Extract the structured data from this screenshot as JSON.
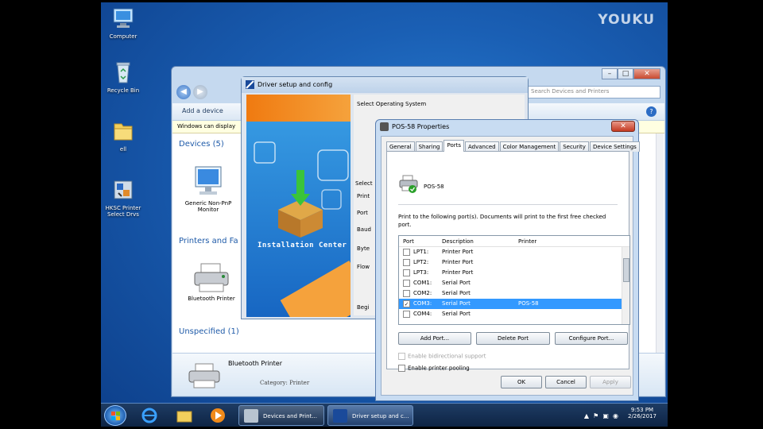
{
  "watermark": "YOUKU",
  "desktop": {
    "icons": [
      {
        "name": "computer",
        "label": "Computer"
      },
      {
        "name": "recycle-bin",
        "label": "Recycle Bin"
      },
      {
        "name": "folder",
        "label": "ell"
      },
      {
        "name": "installer",
        "label": "HKSC Printer\nSelect Drvs"
      }
    ]
  },
  "explorer": {
    "search_placeholder": "Search Devices and Printers",
    "add_device": "Add a device",
    "infobar": "Windows can display",
    "devices_header": "Devices (5)",
    "device_monitor": "Generic Non-PnP Monitor",
    "printers_header": "Printers and Fa",
    "printer_bt": "Bluetooth Printer",
    "unspecified_header": "Unspecified (1)",
    "details_name": "Bluetooth Printer",
    "details_category": "Category:  Printer"
  },
  "driver": {
    "title": "Driver setup and config",
    "select_os": "Select Operating System",
    "banner_label": "Installation Center",
    "side_labels": [
      "Select",
      "Print",
      "Port",
      "Baud",
      "Byte",
      "Flow"
    ],
    "bottom_label": "Begi"
  },
  "props": {
    "title": "POS-58 Properties",
    "tabs": [
      "General",
      "Sharing",
      "Ports",
      "Advanced",
      "Color Management",
      "Security",
      "Device Settings"
    ],
    "active_tab": "Ports",
    "printer_name": "POS-58",
    "description": "Print to the following port(s). Documents will print to the first free checked port.",
    "columns": {
      "port": "Port",
      "description": "Description",
      "printer": "Printer"
    },
    "ports": [
      {
        "port": "LPT1:",
        "description": "Printer Port",
        "printer": "",
        "checked": false,
        "selected": false
      },
      {
        "port": "LPT2:",
        "description": "Printer Port",
        "printer": "",
        "checked": false,
        "selected": false
      },
      {
        "port": "LPT3:",
        "description": "Printer Port",
        "printer": "",
        "checked": false,
        "selected": false
      },
      {
        "port": "COM1:",
        "description": "Serial Port",
        "printer": "",
        "checked": false,
        "selected": false
      },
      {
        "port": "COM2:",
        "description": "Serial Port",
        "printer": "",
        "checked": false,
        "selected": false
      },
      {
        "port": "COM3:",
        "description": "Serial Port",
        "printer": "POS-58",
        "checked": true,
        "selected": true
      },
      {
        "port": "COM4:",
        "description": "Serial Port",
        "printer": "",
        "checked": false,
        "selected": false
      }
    ],
    "add_port": "Add Port...",
    "delete_port": "Delete Port",
    "configure_port": "Configure Port...",
    "bidirectional": "Enable bidirectional support",
    "pooling": "Enable printer pooling",
    "ok": "OK",
    "cancel": "Cancel",
    "apply": "Apply"
  },
  "taskbar": {
    "tasks": [
      {
        "label": "Devices and Print..."
      },
      {
        "label": "Driver setup and c..."
      }
    ],
    "time": "9:53 PM",
    "date": "2/26/2017"
  }
}
